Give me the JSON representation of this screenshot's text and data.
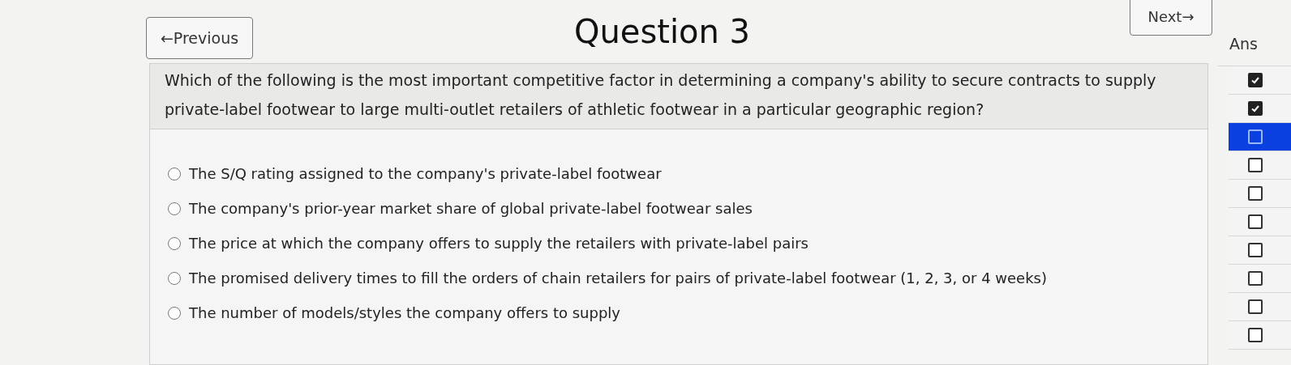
{
  "nav": {
    "previous": "←Previous",
    "title": "Question 3",
    "next": "Next→"
  },
  "question": {
    "text": "Which of the following is the most important competitive factor in determining a company's ability to secure contracts to supply private-label footwear to large multi-outlet retailers of athletic footwear in a particular geographic region?",
    "options": [
      {
        "label": "The S/Q rating assigned to the company's private-label footwear",
        "selected": false
      },
      {
        "label": "The company's prior-year market share of global private-label footwear sales",
        "selected": false
      },
      {
        "label": "The price at which the company offers to supply the retailers with private-label pairs",
        "selected": false
      },
      {
        "label": "The promised delivery times to fill the orders of chain retailers for pairs of private-label footwear (1, 2, 3, or 4 weeks)",
        "selected": false
      },
      {
        "label": "The number of models/styles the company offers to supply",
        "selected": false
      }
    ]
  },
  "answers": {
    "heading": "Ans",
    "items": [
      {
        "checked": true,
        "selected": false
      },
      {
        "checked": true,
        "selected": false
      },
      {
        "checked": false,
        "selected": true
      },
      {
        "checked": false,
        "selected": false
      },
      {
        "checked": false,
        "selected": false
      },
      {
        "checked": false,
        "selected": false
      },
      {
        "checked": false,
        "selected": false
      },
      {
        "checked": false,
        "selected": false
      },
      {
        "checked": false,
        "selected": false
      },
      {
        "checked": false,
        "selected": false
      }
    ]
  }
}
